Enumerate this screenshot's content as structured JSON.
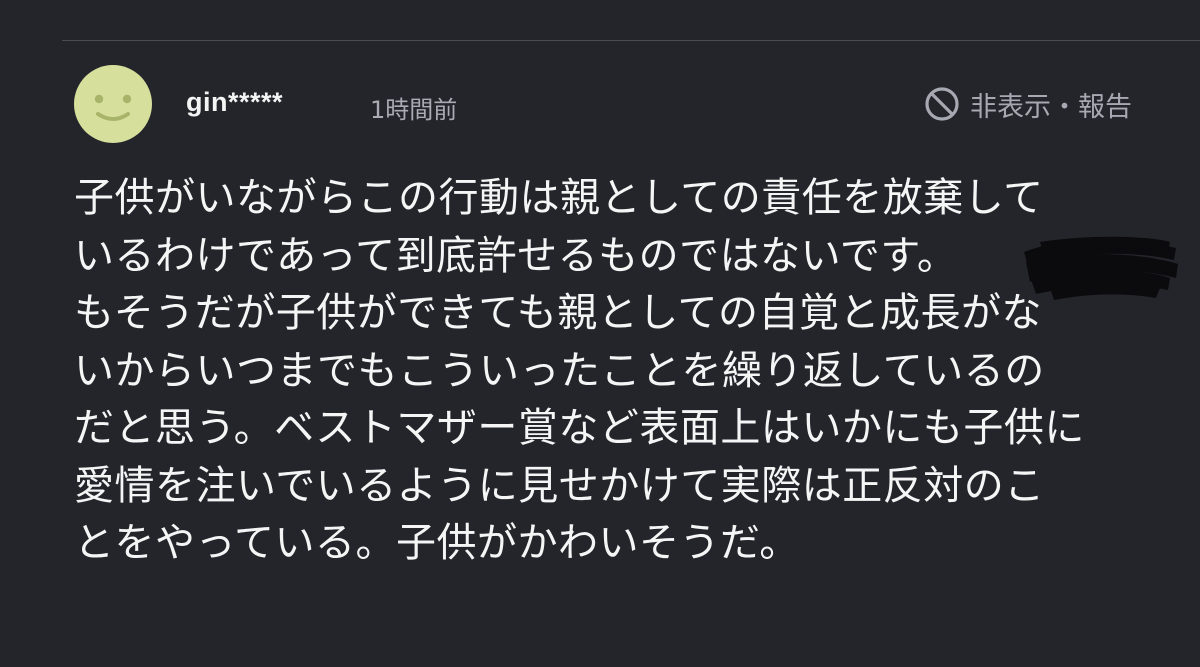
{
  "comment": {
    "username": "gin*****",
    "timestamp": "1時間前",
    "hide_report_label": "非表示・報告",
    "body_lines": [
      "子供がいながらこの行動は親としての責任を放棄して",
      "いるわけであって到底許せるものではないです。",
      "もそうだが子供ができても親としての自覚と成長がな",
      "いからいつまでもこういったことを繰り返しているの",
      "だと思う。ベストマザー賞など表面上はいかにも子供に",
      "愛情を注いでいるように見せかけて実際は正反対のこ",
      "とをやっている。子供がかわいそうだ。"
    ]
  },
  "colors": {
    "background": "#23252b",
    "avatar": "#d6df9c",
    "avatar_face": "#a8b46a",
    "muted_text": "#a6a9b1"
  },
  "icons": {
    "avatar": "smiley-face-icon",
    "hide_report": "ban-icon"
  }
}
